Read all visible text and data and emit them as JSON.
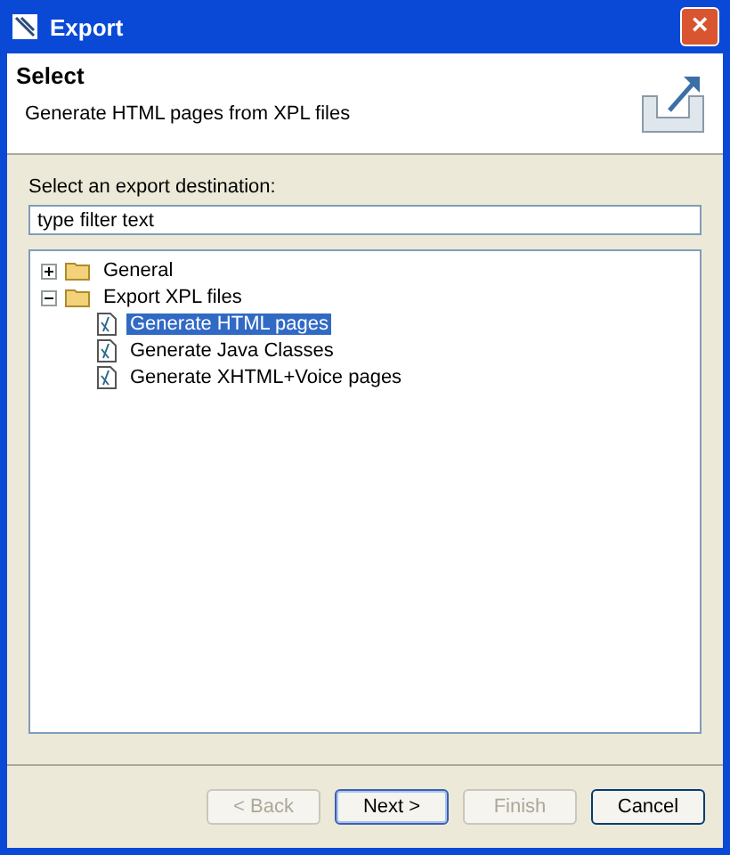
{
  "window": {
    "title": "Export",
    "close": "×"
  },
  "header": {
    "title": "Select",
    "description": "Generate HTML pages from XPL files"
  },
  "destination": {
    "label": "Select an export destination:",
    "filter": {
      "placeholder": "type filter text"
    }
  },
  "tree": [
    {
      "label": "General",
      "expanded": false,
      "selected": false
    },
    {
      "label": "Export XPL files",
      "expanded": true,
      "selected": false,
      "children": [
        {
          "label": "Generate HTML pages",
          "selected": true
        },
        {
          "label": "Generate Java Classes",
          "selected": false
        },
        {
          "label": "Generate XHTML+Voice pages",
          "selected": false
        }
      ]
    }
  ],
  "buttons": [
    {
      "label": "< Back",
      "disabled": true,
      "default": false
    },
    {
      "label": "Next >",
      "disabled": false,
      "default": true
    },
    {
      "label": "Finish",
      "disabled": true,
      "default": false
    },
    {
      "label": "Cancel",
      "disabled": false,
      "default": false
    }
  ]
}
